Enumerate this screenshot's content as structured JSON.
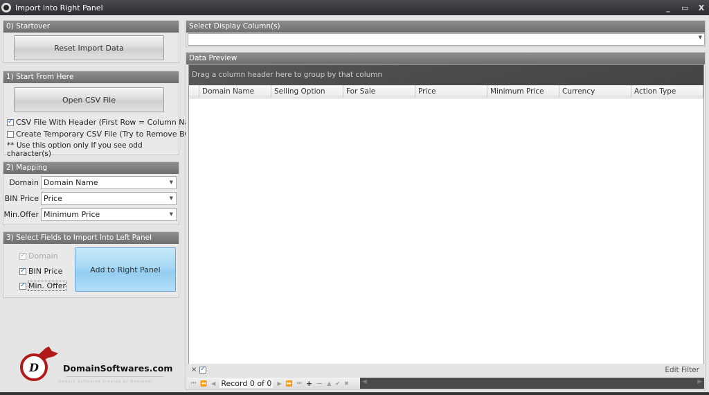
{
  "window": {
    "title": "Import into Right Panel",
    "controls": {
      "minimize": "_",
      "maximize": "▭",
      "close": "X"
    }
  },
  "startover": {
    "header": "0) Startover",
    "reset_button": "Reset Import Data"
  },
  "start": {
    "header": "1) Start From Here",
    "open_button": "Open CSV File",
    "csv_header_option": {
      "label": "CSV File With Header (First Row = Column Name)",
      "checked": true
    },
    "temp_csv_option": {
      "label": "Create Temporary CSV File (Try to Remove BOM)",
      "checked": false
    },
    "note": "** Use this option only If you see odd character(s)"
  },
  "mapping": {
    "header": "2) Mapping",
    "rows": [
      {
        "label": "Domain",
        "value": "Domain Name"
      },
      {
        "label": "BIN Price",
        "value": "Price"
      },
      {
        "label": "Min.Offer",
        "value": "Minimum Price"
      }
    ]
  },
  "select_fields": {
    "header": "3) Select Fields to Import Into Left Panel",
    "fields": [
      {
        "label": "Domain",
        "checked": true,
        "disabled": true
      },
      {
        "label": "BIN Price",
        "checked": true,
        "disabled": false
      },
      {
        "label": "Min. Offer",
        "checked": true,
        "disabled": false
      }
    ],
    "add_button": "Add to Right Panel"
  },
  "logo": {
    "letter": "D",
    "brand": "DomainSoftwares.com",
    "tagline": "Domain Softwares Created by Domainer"
  },
  "display_columns": {
    "header": "Select Display Column(s)",
    "value": ""
  },
  "data_preview": {
    "header": "Data Preview",
    "group_panel_text": "Drag a column header here to group by that column",
    "columns": [
      "Domain Name",
      "Selling Option",
      "For Sale",
      "Price",
      "Minimum Price",
      "Currency",
      "Action Type"
    ],
    "rows": [],
    "filter": {
      "close": "×",
      "enabled": true,
      "edit_label": "Edit Filter"
    },
    "navigator": {
      "record_text": "Record 0 of 0",
      "buttons": [
        "first",
        "prev-page",
        "prev",
        "next",
        "next-page",
        "last",
        "append",
        "delete",
        "edit",
        "end-edit",
        "cancel-edit"
      ]
    }
  }
}
